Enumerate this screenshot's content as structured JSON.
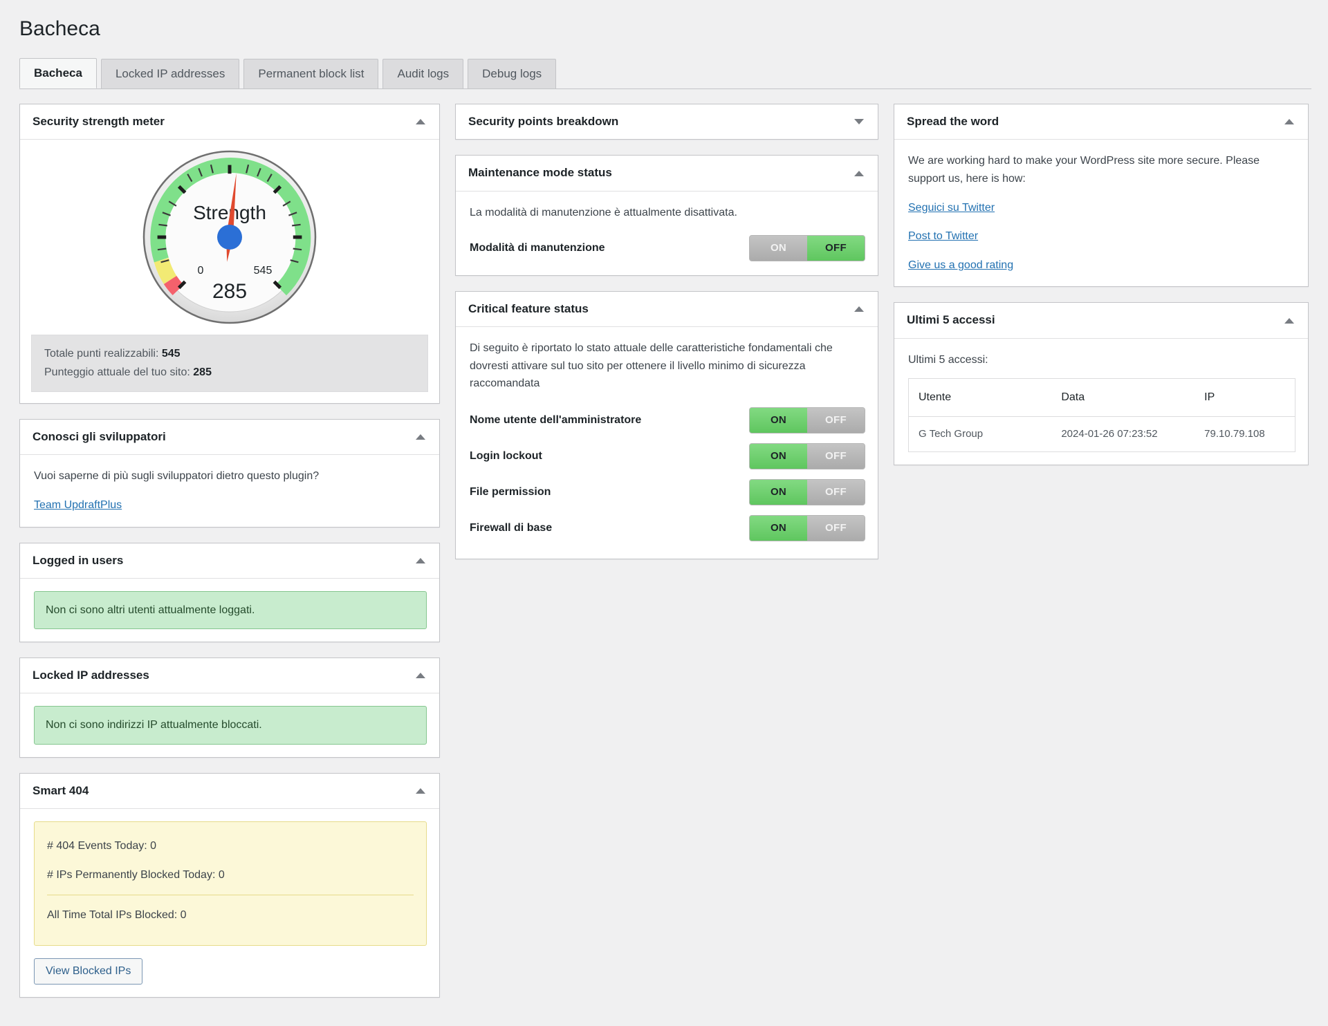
{
  "header": {
    "title": "Bacheca"
  },
  "tabs": [
    {
      "label": "Bacheca",
      "active": true
    },
    {
      "label": "Locked IP addresses",
      "active": false
    },
    {
      "label": "Permanent block list",
      "active": false
    },
    {
      "label": "Audit logs",
      "active": false
    },
    {
      "label": "Debug logs",
      "active": false
    }
  ],
  "security_strength": {
    "title": "Security strength meter",
    "caret": "up",
    "gauge": {
      "label": "Strength",
      "value": "285",
      "min_label": "0",
      "max_label": "545",
      "min": 0,
      "max": 545,
      "needle_color": "#e04a2f",
      "hub_color": "#2b6fd6",
      "band_red": "#f4616c",
      "band_yellow": "#f2ea74",
      "band_green": "#7fe08a"
    },
    "total_points_label": "Totale punti realizzabili:",
    "total_points_value": "545",
    "current_score_label": "Punteggio attuale del tuo sito:",
    "current_score_value": "285"
  },
  "developers": {
    "title": "Conosci gli sviluppatori",
    "caret": "up",
    "text": "Vuoi saperne di più sugli sviluppatori dietro questo plugin?",
    "link": "Team UpdraftPlus"
  },
  "logged_in_users": {
    "title": "Logged in users",
    "caret": "up",
    "notice": "Non ci sono altri utenti attualmente loggati."
  },
  "locked_ip": {
    "title": "Locked IP addresses",
    "caret": "up",
    "notice": "Non ci sono indirizzi IP attualmente bloccati."
  },
  "smart404": {
    "title": "Smart 404",
    "caret": "up",
    "events_today": "# 404 Events Today: 0",
    "ips_blocked_today": "# IPs Permanently Blocked Today: 0",
    "all_time_blocked": "All Time Total IPs Blocked: 0",
    "button": "View Blocked IPs"
  },
  "points_breakdown": {
    "title": "Security points breakdown",
    "caret": "down"
  },
  "maintenance": {
    "title": "Maintenance mode status",
    "caret": "up",
    "status_text": "La modalità di manutenzione è attualmente disattivata.",
    "row_label": "Modalità di manutenzione",
    "on_label": "ON",
    "off_label": "OFF",
    "state": "OFF"
  },
  "critical_features": {
    "title": "Critical feature status",
    "caret": "up",
    "description": "Di seguito è riportato lo stato attuale delle caratteristiche fondamentali che dovresti attivare sul tuo sito per ottenere il livello minimo di sicurezza raccomandata",
    "on_label": "ON",
    "off_label": "OFF",
    "rows": [
      {
        "label": "Nome utente dell'amministratore",
        "state": "ON"
      },
      {
        "label": "Login lockout",
        "state": "ON"
      },
      {
        "label": "File permission",
        "state": "ON"
      },
      {
        "label": "Firewall di base",
        "state": "ON"
      }
    ]
  },
  "spread_word": {
    "title": "Spread the word",
    "caret": "up",
    "text": "We are working hard to make your WordPress site more secure. Please support us, here is how:",
    "links": [
      "Seguici su Twitter",
      "Post to Twitter",
      "Give us a good rating"
    ]
  },
  "last_logins": {
    "title": "Ultimi 5 accessi",
    "caret": "up",
    "subtitle": "Ultimi 5 accessi:",
    "columns": [
      "Utente",
      "Data",
      "IP"
    ],
    "rows": [
      {
        "user": "G Tech Group",
        "date": "2024-01-26 07:23:52",
        "ip": "79.10.79.108"
      }
    ]
  }
}
